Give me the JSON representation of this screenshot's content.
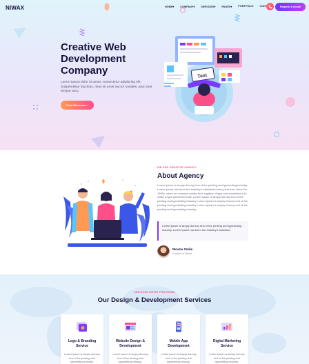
{
  "header": {
    "logo": "NIWAX",
    "nav": [
      "HOME▾",
      "COMPANY▾",
      "SERVICES▾",
      "PAGES▾",
      "PORTFOLIO",
      "CONTACT"
    ],
    "cta": "Request A Quote",
    "phone_icon": "phone-icon"
  },
  "hero": {
    "title": "Creative Web Development Company",
    "text": "Lorem ipsum dolor sit amet, consectetur adipiscing elit. Suspendisse faucibus, risus sit amet auctor sodales, justo erat tempor arcu.",
    "button": "View Showcase ›",
    "illustration_label": "Text"
  },
  "about": {
    "eyebrow": "WE ARE CREATIVE AGENCY",
    "title": "About Agency",
    "text": "Lorem Ipsum is simply dummy text of the printing and typesetting industry. Lorem Ipsum has been the industry's standard dummy text ever since the 1500s, when an unknown printer took a galley of type and scrambled it to make a type specimen book. Lorem Ipsum is simply dummy text of the printing and typesetting industry. Lorem Ipsum is simply dummy text of the printing and typesetting industry. Lorem Ipsum is simply dummy text of the printing and typesetting industry.",
    "quote": "Lorem Ipsum is simply dummy text of the printing and typesetting industry. Lorem Ipsum has been the industry's standard.",
    "author_name": "Moana Smile",
    "author_role": "Founder of Niwax"
  },
  "services": {
    "eyebrow": "SERVICES WE'RE PROVIDING",
    "title": "Our Design & Development Services",
    "cards": [
      {
        "name": "Logo & Branding Service",
        "text": "Lorem Ipsum is simply dummy text of the printing and typesetting industry.",
        "icon": "logo-branding-icon"
      },
      {
        "name": "Website Design & Development",
        "text": "Lorem Ipsum is simply dummy text of the printing and typesetting industry.",
        "icon": "web-design-icon"
      },
      {
        "name": "Mobile App Development",
        "text": "Lorem Ipsum is simply dummy text of the printing and typesetting industry.",
        "icon": "mobile-app-icon"
      },
      {
        "name": "Digital Marketing Service",
        "text": "Lorem Ipsum is simply dummy text of the printing and typesetting industry.",
        "icon": "digital-marketing-icon"
      }
    ]
  },
  "colors": {
    "accent_pink": "#ff4f8b",
    "accent_purple": "#6a36ff",
    "heading": "#15123a"
  }
}
